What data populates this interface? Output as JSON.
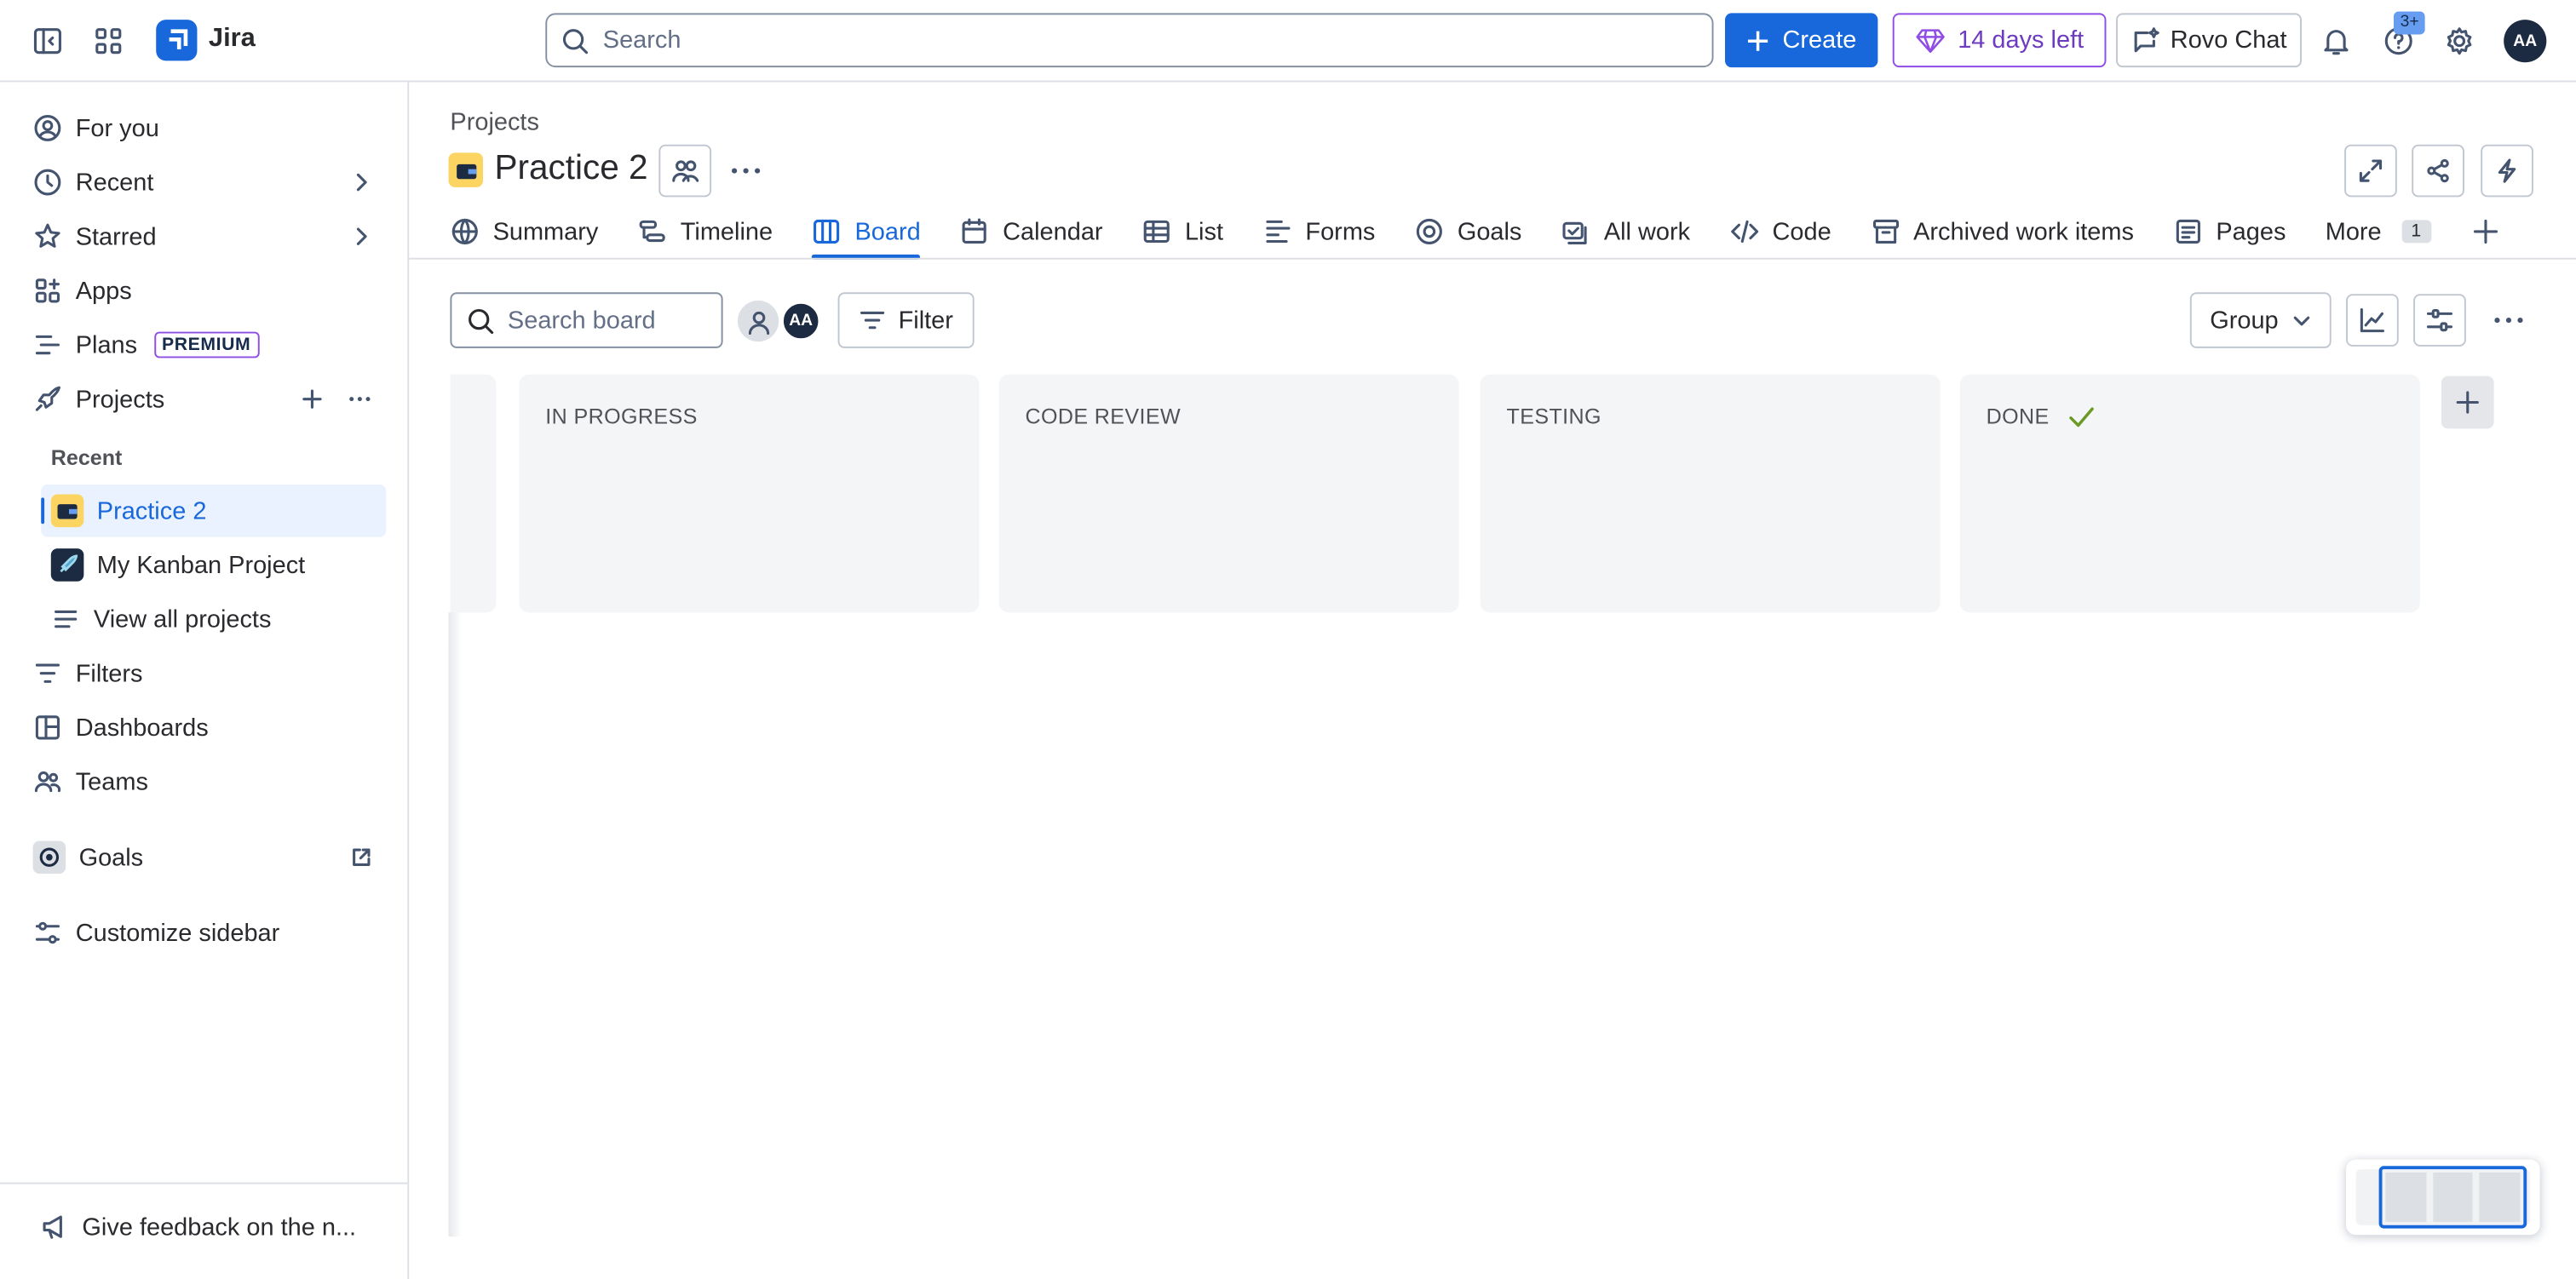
{
  "topbar": {
    "app_name": "Jira",
    "search_placeholder": "Search",
    "create_label": "Create",
    "trial_label": "14 days left",
    "rovo_label": "Rovo Chat",
    "help_badge": "3+",
    "avatar_initials": "AA"
  },
  "sidebar": {
    "items": [
      {
        "label": "For you"
      },
      {
        "label": "Recent"
      },
      {
        "label": "Starred"
      },
      {
        "label": "Apps"
      },
      {
        "label": "Plans",
        "badge": "PREMIUM"
      },
      {
        "label": "Projects"
      }
    ],
    "recent_label": "Recent",
    "projects": [
      {
        "label": "Practice 2"
      },
      {
        "label": "My Kanban Project"
      },
      {
        "label": "View all projects"
      }
    ],
    "items_bottom": [
      {
        "label": "Filters"
      },
      {
        "label": "Dashboards"
      },
      {
        "label": "Teams"
      },
      {
        "label": "Goals"
      },
      {
        "label": "Customize sidebar"
      }
    ],
    "feedback_label": "Give feedback on the n..."
  },
  "main": {
    "breadcrumb": "Projects",
    "project_title": "Practice 2",
    "tabs": [
      {
        "label": "Summary"
      },
      {
        "label": "Timeline"
      },
      {
        "label": "Board"
      },
      {
        "label": "Calendar"
      },
      {
        "label": "List"
      },
      {
        "label": "Forms"
      },
      {
        "label": "Goals"
      },
      {
        "label": "All work"
      },
      {
        "label": "Code"
      },
      {
        "label": "Archived work items"
      },
      {
        "label": "Pages"
      },
      {
        "label": "More",
        "count": "1"
      }
    ],
    "board_search_placeholder": "Search board",
    "avatar_initials": "AA",
    "filter_label": "Filter",
    "group_label": "Group",
    "columns": [
      {
        "title": "IN PROGRESS"
      },
      {
        "title": "CODE REVIEW"
      },
      {
        "title": "TESTING"
      },
      {
        "title": "DONE"
      }
    ]
  },
  "colors": {
    "brand": "#1868db",
    "premium": "#8f4de5",
    "column_bg": "#f4f5f7",
    "done_check": "#6a9a23"
  }
}
